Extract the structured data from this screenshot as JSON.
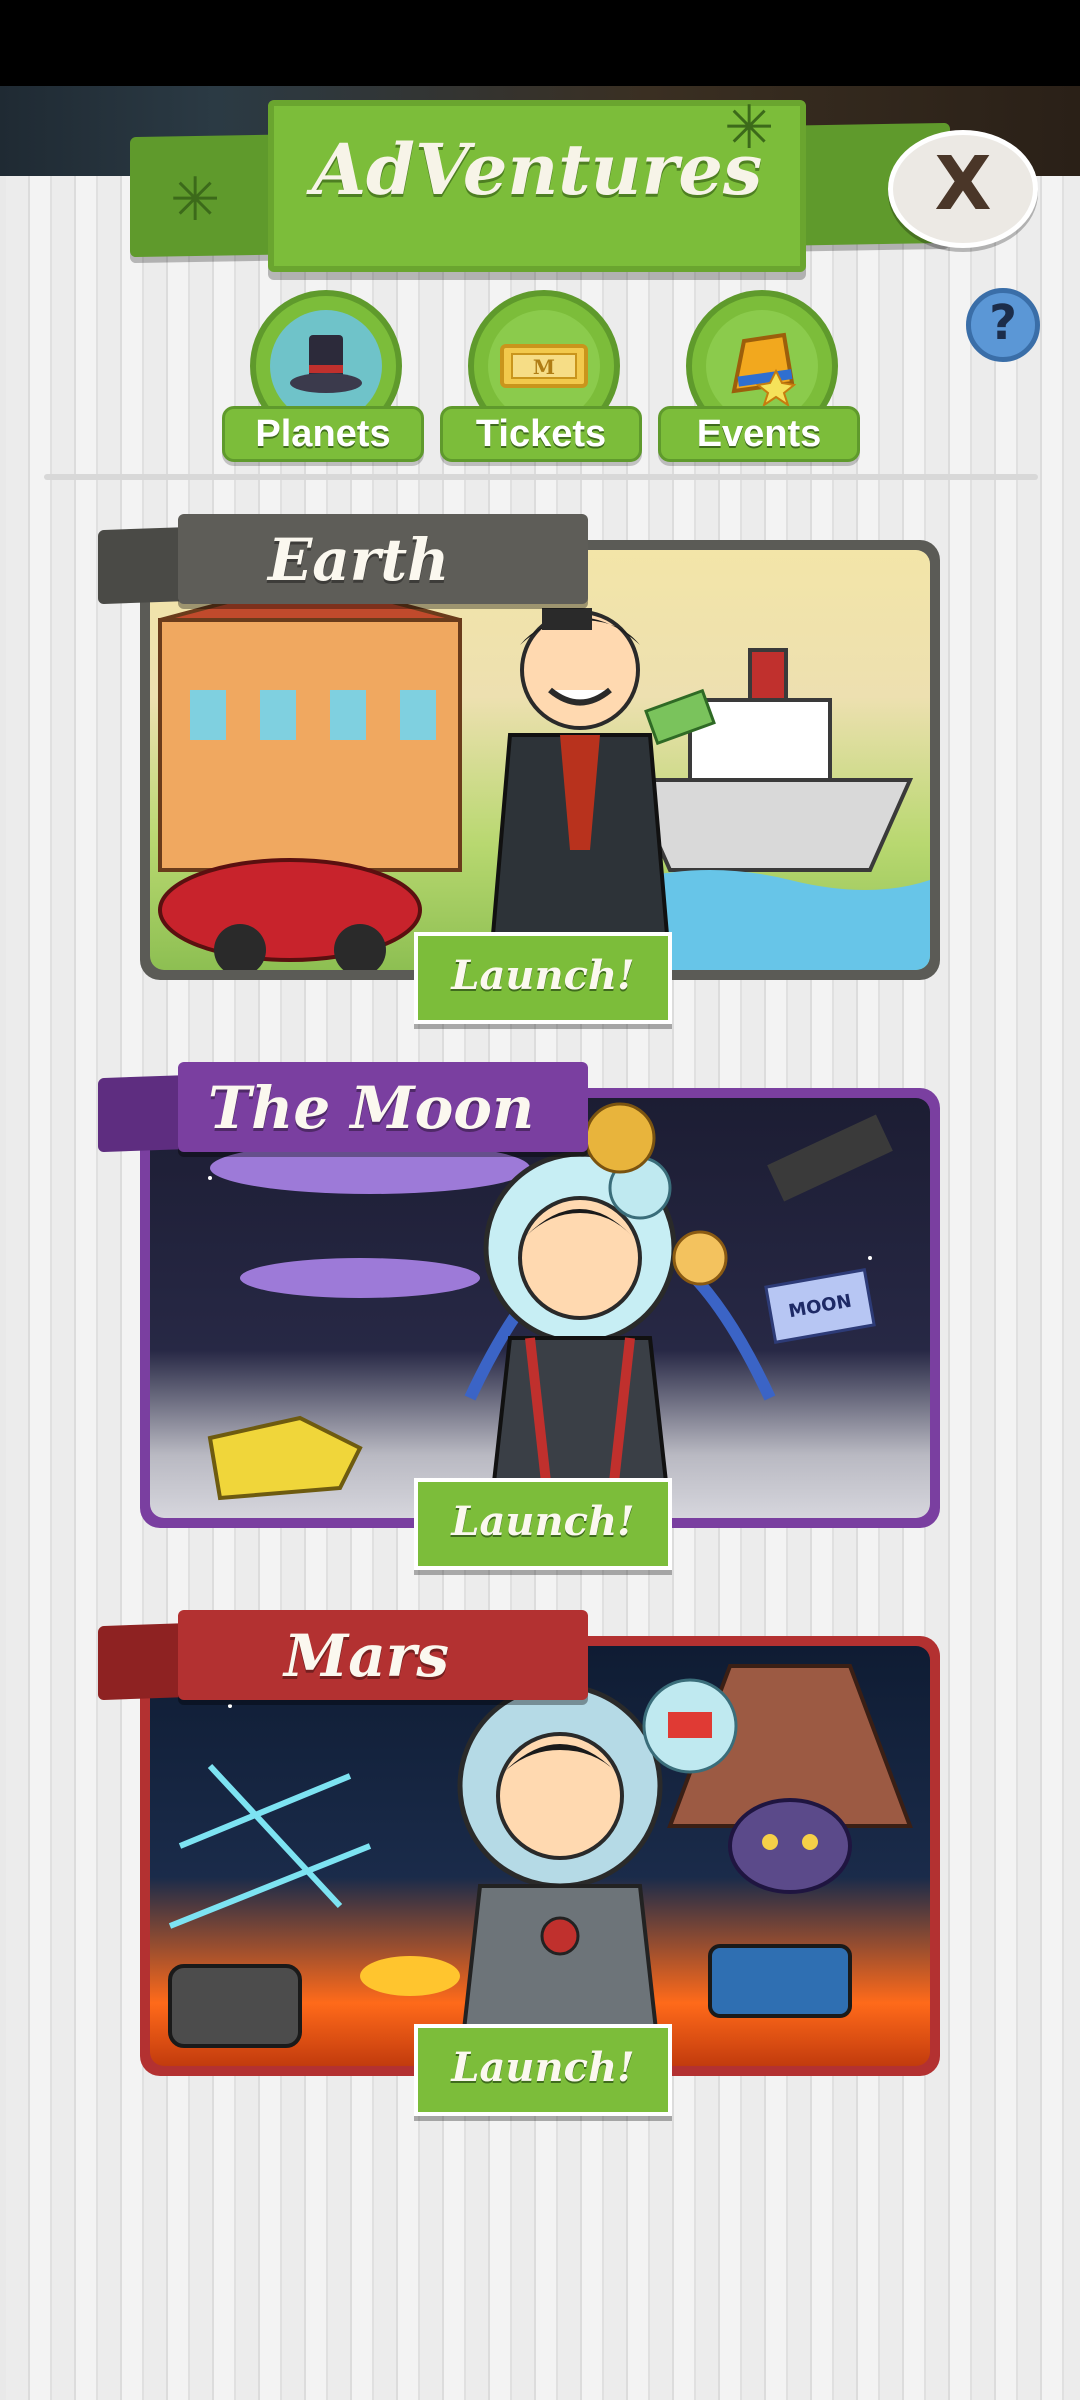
{
  "app": {
    "title": "AdVentures",
    "close_label": "X",
    "help_label": "?"
  },
  "tabs": [
    {
      "label": "Planets",
      "icon": "top-hat-icon"
    },
    {
      "label": "Tickets",
      "icon": "ticket-icon"
    },
    {
      "label": "Events",
      "icon": "event-hat-icon"
    }
  ],
  "planets": [
    {
      "name": "Earth",
      "launch_label": "Launch!",
      "color": "#5b5b56"
    },
    {
      "name": "The Moon",
      "launch_label": "Launch!",
      "color": "#7a3fa0"
    },
    {
      "name": "Mars",
      "launch_label": "Launch!",
      "color": "#b33131"
    }
  ],
  "colors": {
    "accent_green": "#7cbd3a",
    "dark_green": "#5f9a2c"
  }
}
